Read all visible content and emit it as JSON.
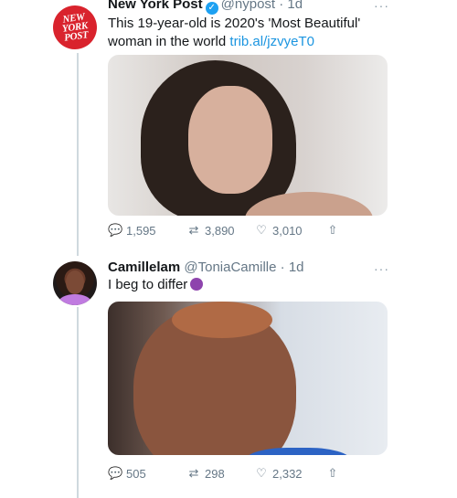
{
  "tweet1": {
    "logo_text": [
      "NEW",
      "YORK",
      "POST"
    ],
    "name": "New York Post",
    "handle": "@nypost",
    "time": "· 1d",
    "more": "···",
    "text": "This 19-year-old is 2020's 'Most Beautiful' woman in the world",
    "link": "trib.al/jzvyeT0",
    "replies": "1,595",
    "retweets": "3,890",
    "likes": "3,010"
  },
  "tweet2": {
    "name": "Camillelam",
    "handle": "@ToniaCamille",
    "time": "· 1d",
    "more": "···",
    "text": "I beg to differ",
    "replies": "505",
    "retweets": "298",
    "likes": "2,332"
  },
  "icons": {
    "reply": "reply-icon",
    "retweet": "retweet-icon",
    "like": "heart-icon",
    "share": "share-icon"
  },
  "colors": {
    "link": "#1b95e0",
    "verified": "#1da1f2",
    "nyp_red": "#d9232d"
  }
}
